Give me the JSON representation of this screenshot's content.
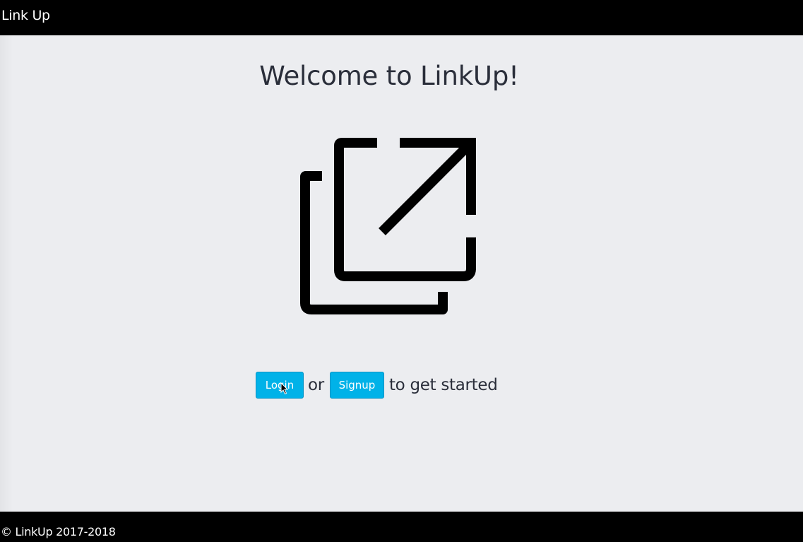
{
  "navbar": {
    "brand": "Link Up"
  },
  "main": {
    "heading": "Welcome to LinkUp!",
    "logo_icon": "external-link-icon",
    "cta": {
      "login_label": "Login",
      "or_text": "or",
      "signup_label": "Signup",
      "tail_text": "to get started"
    }
  },
  "footer": {
    "copyright": "© LinkUp 2017-2018"
  },
  "colors": {
    "background": "#ecedf0",
    "bars": "#000000",
    "button": "#00b2e8",
    "text": "#2a2e3a"
  }
}
